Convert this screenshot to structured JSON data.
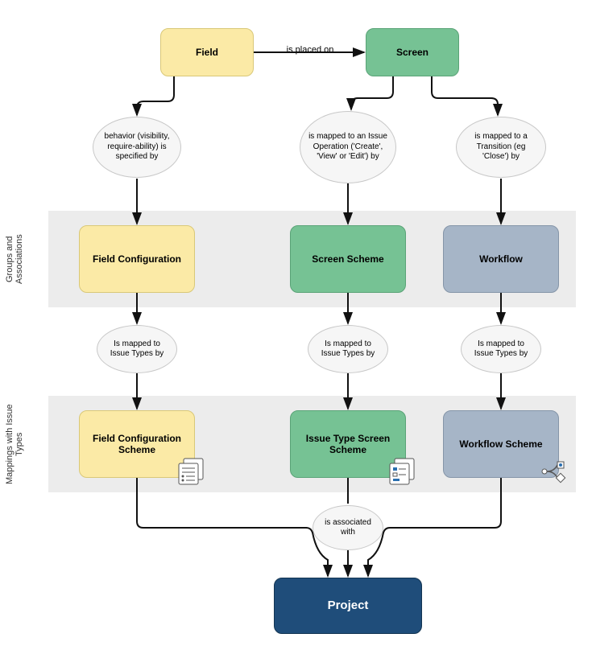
{
  "nodes": {
    "field": "Field",
    "screen": "Screen",
    "fieldConfig": "Field Configuration",
    "screenScheme": "Screen Scheme",
    "workflow": "Workflow",
    "fieldConfigScheme": "Field Configuration Scheme",
    "issueTypeScreenScheme": "Issue Type Screen Scheme",
    "workflowScheme": "Workflow Scheme",
    "project": "Project"
  },
  "edges": {
    "placedOn": "is placed on",
    "fieldBehavior": "behavior (visibility, require-ability) is specified by",
    "issueOp": "is mapped to an Issue Operation ('Create', 'View' or 'Edit') by",
    "transition": "is mapped to a Transition (eg 'Close') by",
    "mappedIssueTypes1": "Is mapped to Issue Types by",
    "mappedIssueTypes2": "Is mapped to Issue Types by",
    "mappedIssueTypes3": "Is mapped to Issue Types by",
    "assocWith": "is associated with"
  },
  "bands": {
    "groups": "Groups and Associations",
    "mappings": "Mappings with Issue Types"
  }
}
